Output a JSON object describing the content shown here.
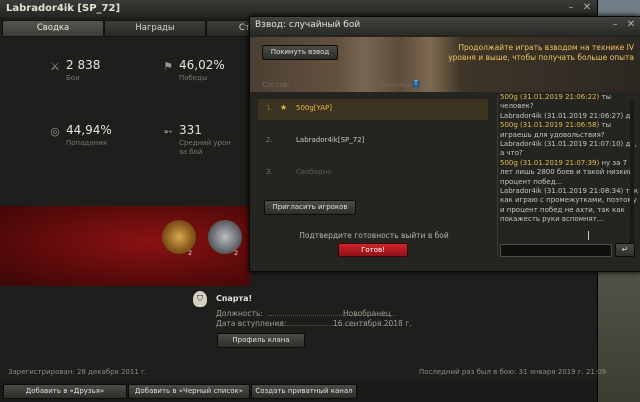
{
  "profile": {
    "title": "Labrador4ik [SP_72]",
    "tabs": [
      "Сводка",
      "Награды",
      "Статист"
    ],
    "stats": [
      {
        "icon": "crossed-swords-icon",
        "value": "2 838",
        "label": "Бои"
      },
      {
        "icon": "flag-icon",
        "value": "46,02%",
        "label": "Победы"
      },
      {
        "icon": "target-icon",
        "value": "44,94%",
        "label": "Попадания"
      },
      {
        "icon": "shell-icon",
        "value": "331",
        "label": "Средний урон за бой"
      }
    ],
    "medals": [
      {
        "icon": "gold-medal-icon",
        "count": "2"
      },
      {
        "icon": "silver-medal-icon",
        "count": "2"
      }
    ],
    "clan": {
      "name": "Спарта!",
      "position_label": "Должность:",
      "position_value": "Новобранец",
      "joined_label": "Дата вступления:",
      "joined_value": "16 сентября 2018 г.",
      "profile_button": "Профиль клана"
    },
    "registered": "Зарегистрирован: 28 декабря 2011 г.",
    "last_battle": "Последний раз был в бою: 31 января 2019 г. 21:09",
    "buttons": {
      "add_friends": "Добавить в «Друзья»",
      "add_blacklist": "Добавить в «Черный список»",
      "private_channel": "Создать приватный канал"
    }
  },
  "platoon": {
    "title": "Взвод: случайный бой",
    "leave_button": "Покинуть взвод",
    "promo_text": "Продолжайте играть взводом на технике IV уровня и выше, чтобы получать больше опыта",
    "col_composition": "Состав:",
    "col_vehicle": "Техника",
    "vehicle_badge": "T",
    "slots": [
      {
        "num": "1.",
        "name": "500g[YAP]",
        "state": "ready",
        "color": "#e6b94a"
      },
      {
        "num": "2.",
        "name": "Labrador4ik[SP_72]",
        "state": "member",
        "color": "#c9c5b8"
      },
      {
        "num": "3.",
        "name": "Свободно",
        "state": "free",
        "color": "#5c594f"
      }
    ],
    "invite_button": "Пригласить игроков",
    "ready_prompt": "Подтвердите готовность выйти в бой",
    "ready_button": "Готов!",
    "chat": [
      {
        "author": "500g (31.01.2019 21:06:22)",
        "author_color": "#e6b94a",
        "text": " ты человек?"
      },
      {
        "author": "Labrador4ik (31.01.2019 21:06:27)",
        "author_color": "#c9c5b8",
        "text": " да"
      },
      {
        "author": "500g (31.01.2019 21:06:58)",
        "author_color": "#e6b94a",
        "text": " ты играешь для удовольствия?"
      },
      {
        "author": "Labrador4ik (31.01.2019 21:07:10)",
        "author_color": "#c9c5b8",
        "text": " да, а что?"
      },
      {
        "author": "500g (31.01.2019 21:07:39)",
        "author_color": "#e6b94a",
        "text": " ну за 7 лет лишь 2800 боев и такой низкий процент побед..."
      },
      {
        "author": "Labrador4ik (31.01.2019 21:08:34)",
        "author_color": "#c9c5b8",
        "text": " так как играю с промежутками, поэтому и процент побед не ахти, так как покажесть руки вспомнят..."
      }
    ],
    "send_icon": "↵"
  },
  "colors": {
    "ready_red": "#c1272d",
    "gold": "#e6b94a",
    "promo_orange": "#f3c65e"
  }
}
